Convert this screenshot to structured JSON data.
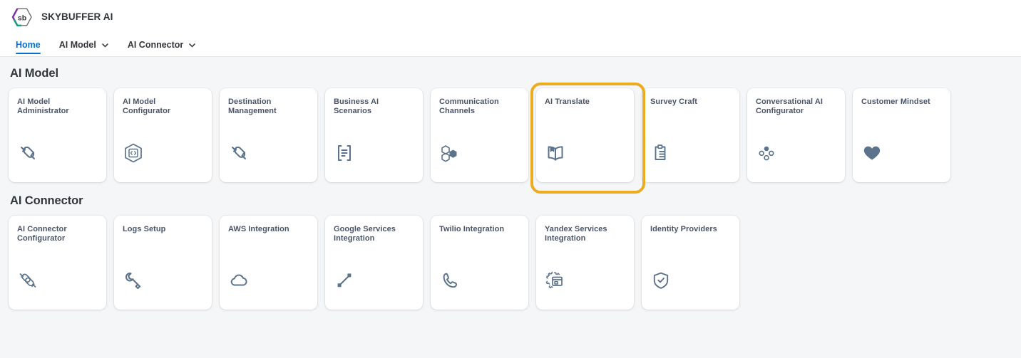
{
  "app": {
    "title": "SKYBUFFER AI",
    "logo_icon": "skybuffer-hexagon-logo"
  },
  "nav": {
    "items": [
      {
        "label": "Home",
        "active": true,
        "has_chevron": false
      },
      {
        "label": "AI Model",
        "active": false,
        "has_chevron": true
      },
      {
        "label": "AI Connector",
        "active": false,
        "has_chevron": true
      }
    ]
  },
  "colors": {
    "accent_blue": "#0a6ed1",
    "selection_orange": "#edab20",
    "icon_slate": "#5b738b",
    "page_background": "#f5f6f7",
    "tile_background": "#ffffff",
    "text_primary": "#32363a",
    "tile_title": "#4a5568"
  },
  "groups": [
    {
      "title": "AI Model",
      "tiles": [
        {
          "title": "AI Model Administrator",
          "icon": "connector-plug-icon",
          "selected": false
        },
        {
          "title": "AI Model Configurator",
          "icon": "hexagon-chip-icon",
          "selected": false
        },
        {
          "title": "Destination Management",
          "icon": "connector-plug-icon",
          "selected": false
        },
        {
          "title": "Business AI Scenarios",
          "icon": "document-list-icon",
          "selected": false
        },
        {
          "title": "Communication Channels",
          "icon": "hexagon-cluster-icon",
          "selected": false
        },
        {
          "title": "AI Translate",
          "icon": "open-book-icon",
          "selected": true
        },
        {
          "title": "Survey Craft",
          "icon": "clipboard-list-icon",
          "selected": false
        },
        {
          "title": "Conversational AI Configurator",
          "icon": "dot-cluster-icon",
          "selected": false
        },
        {
          "title": "Customer Mindset",
          "icon": "heart-icon",
          "selected": false
        }
      ]
    },
    {
      "title": "AI Connector",
      "tiles": [
        {
          "title": "AI Connector Configurator",
          "icon": "connector-plug-pair-icon",
          "selected": false
        },
        {
          "title": "Logs Setup",
          "icon": "wrench-icon",
          "selected": false
        },
        {
          "title": "AWS Integration",
          "icon": "cloud-icon",
          "selected": false
        },
        {
          "title": "Google Services Integration",
          "icon": "diagonal-link-icon",
          "selected": false
        },
        {
          "title": "Twilio Integration",
          "icon": "phone-icon",
          "selected": false
        },
        {
          "title": "Yandex Services Integration",
          "icon": "gear-window-icon",
          "selected": false
        },
        {
          "title": "Identity Providers",
          "icon": "shield-check-icon",
          "selected": false
        }
      ]
    }
  ]
}
